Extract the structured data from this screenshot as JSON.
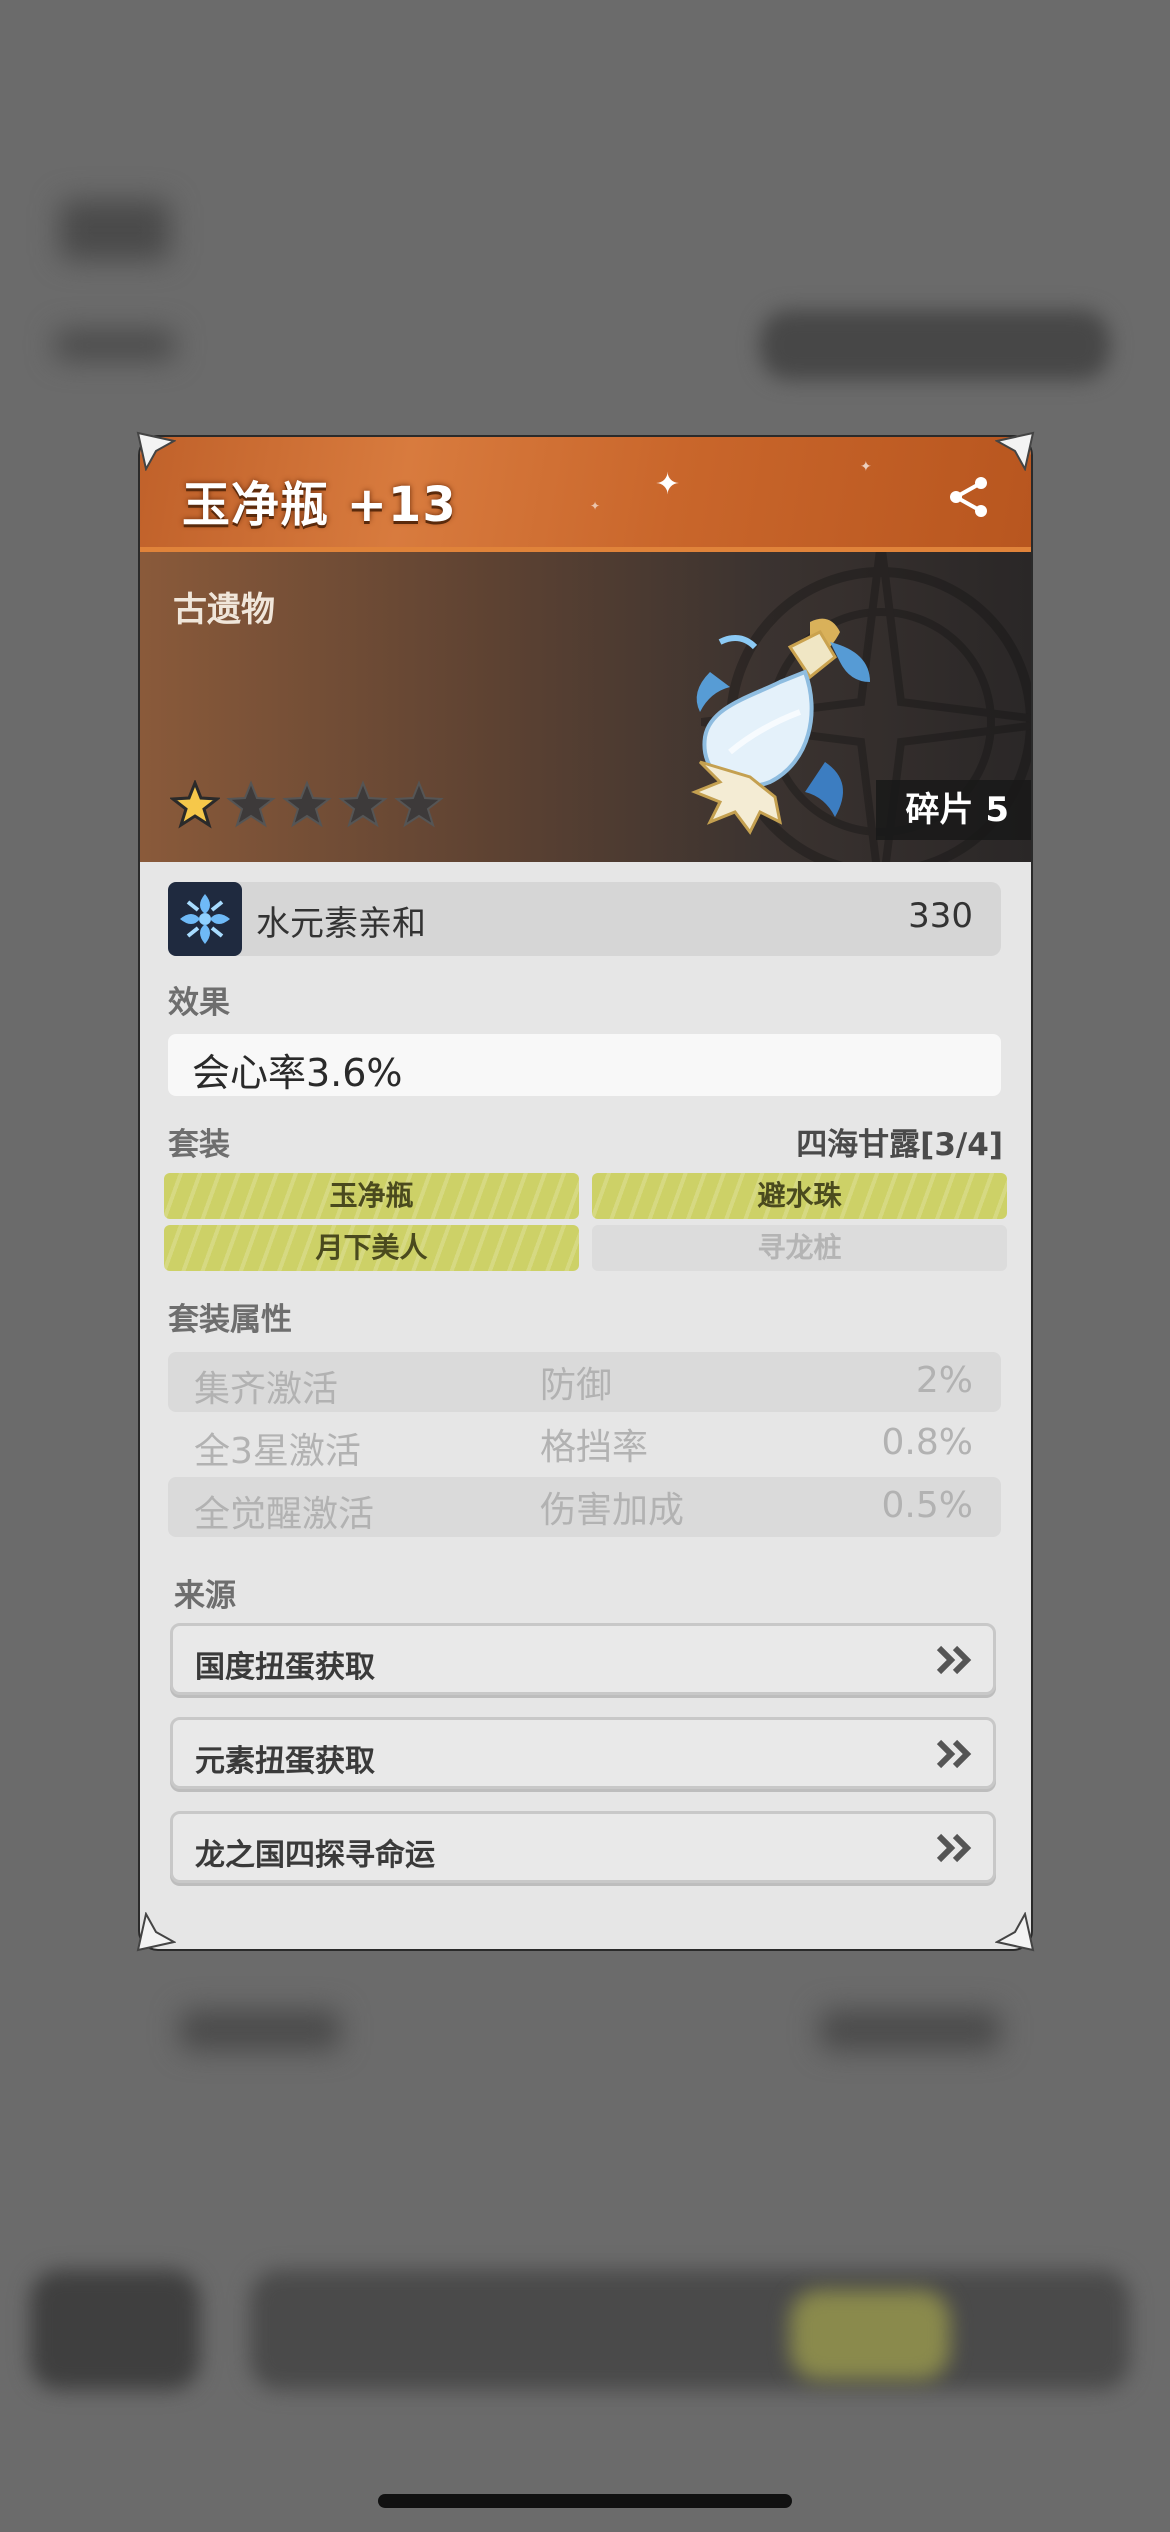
{
  "item": {
    "name": "玉净瓶 +13",
    "category": "古遗物",
    "rarity_stars": 1,
    "max_stars": 5,
    "shard_label": "碎片 5"
  },
  "element": {
    "name": "水元素亲和",
    "value": "330",
    "icon": "water-element-icon"
  },
  "effect": {
    "label": "效果",
    "text": "会心率3.6%"
  },
  "set": {
    "label": "套装",
    "name": "四海甘露[3/4]",
    "pieces": [
      {
        "name": "玉净瓶",
        "collected": true
      },
      {
        "name": "避水珠",
        "collected": true
      },
      {
        "name": "月下美人",
        "collected": true
      },
      {
        "name": "寻龙桩",
        "collected": false
      }
    ]
  },
  "set_attributes": {
    "label": "套装属性",
    "rows": [
      {
        "condition": "集齐激活",
        "attribute": "防御",
        "value": "2%"
      },
      {
        "condition": "全3星激活",
        "attribute": "格挡率",
        "value": "0.8%"
      },
      {
        "condition": "全觉醒激活",
        "attribute": "伤害加成",
        "value": "0.5%"
      }
    ]
  },
  "sources": {
    "label": "来源",
    "items": [
      "国度扭蛋获取",
      "元素扭蛋获取",
      "龙之国四探寻命运"
    ]
  },
  "colors": {
    "title_bar": "#c9662b",
    "set_active": "#cdd167",
    "set_inactive": "#dcdcdc"
  }
}
